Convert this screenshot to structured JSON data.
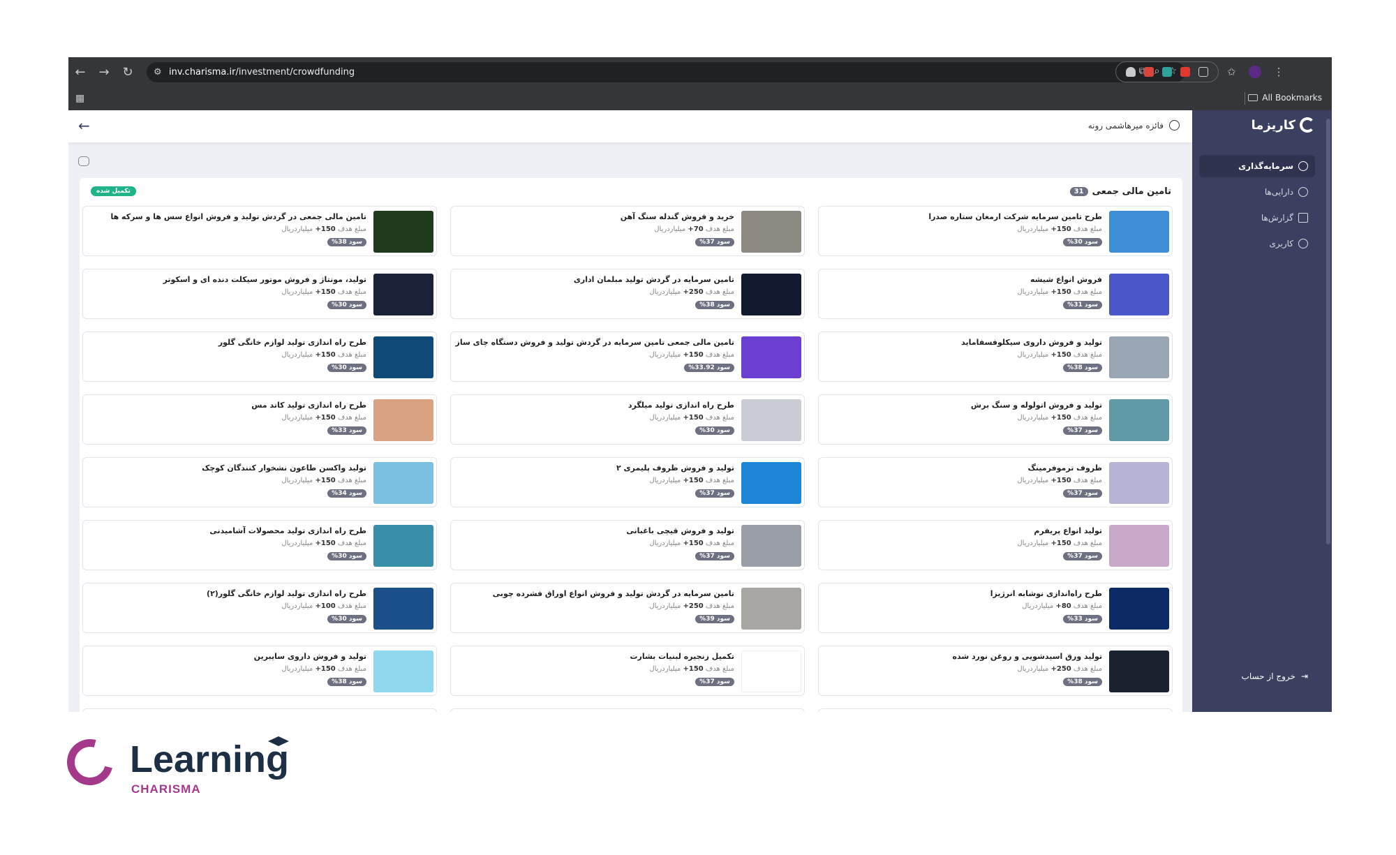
{
  "browser": {
    "url_host": "inv.charisma.ir",
    "url_path": "/investment/crowdfunding",
    "all_bookmarks": "All Bookmarks"
  },
  "sidebar": {
    "brand": "کاریزما",
    "items": [
      {
        "label": "سرمایه‌گذاری",
        "active": true,
        "icon": "chart-icon"
      },
      {
        "label": "دارایی‌ها",
        "active": false,
        "icon": "pie-icon"
      },
      {
        "label": "گزارش‌ها",
        "active": false,
        "icon": "document-icon"
      },
      {
        "label": "کاربری",
        "active": false,
        "icon": "user-icon"
      }
    ],
    "logout": "خروج از حساب"
  },
  "topbar": {
    "user_name": "فائزه میرهاشمی رونه"
  },
  "panel": {
    "title": "تامین مالی جمعی",
    "count": "31",
    "done_badge": "تکمیل شده"
  },
  "target_prefix": "مبلغ هدف",
  "unit": "میلیارد‌ریال",
  "profit_label": "سود",
  "cards": [
    {
      "title": "طرح تامین سرمایه شرکت ارمغان ستاره صدرا",
      "target": "150+",
      "profit": "30%",
      "color": "#3f8fd6"
    },
    {
      "title": "خرید و فروش گندله سنگ آهن",
      "target": "70+",
      "profit": "37%",
      "color": "#8d8a82"
    },
    {
      "title": "تامین مالی جمعی در گردش تولید و فروش انواع سس ها و سرکه ها",
      "target": "150+",
      "profit": "38%",
      "color": "#1f3a1c"
    },
    {
      "title": "فروش انواع شیشه",
      "target": "150+",
      "profit": "31%",
      "color": "#4b56c9"
    },
    {
      "title": "تامین سرمایه در گردش تولید مبلمان اداری",
      "target": "250+",
      "profit": "38%",
      "color": "#111a2e"
    },
    {
      "title": "تولید، مونتاژ و فروش موتور سیکلت دنده ای و اسکوتر",
      "target": "150+",
      "profit": "30%",
      "color": "#1a2238"
    },
    {
      "title": "تولید و فروش داروی سیکلوفسفاماید",
      "target": "150+",
      "profit": "38%",
      "color": "#9aa6b4"
    },
    {
      "title": "تامین مالی جمعی تامین سرمایه در گردش تولید و فروش دستگاه چای ساز",
      "target": "150+",
      "profit": "33.92%",
      "color": "#6b3fd1"
    },
    {
      "title": "طرح راه اندازی تولید لوازم خانگی گلور",
      "target": "150+",
      "profit": "30%",
      "color": "#0f4a78"
    },
    {
      "title": "تولید و فروش اتولوله و سنگ برش",
      "target": "150+",
      "profit": "37%",
      "color": "#5f9aa6"
    },
    {
      "title": "طرح راه اندازی تولید میلگرد",
      "target": "150+",
      "profit": "30%",
      "color": "#c9ccd2"
    },
    {
      "title": "طرح راه اندازی تولید کاتد مس",
      "target": "150+",
      "profit": "33%",
      "color": "#d9a383"
    },
    {
      "title": "ظروف ترموفرمینگ",
      "target": "150+",
      "profit": "37%",
      "color": "#b8b4d6"
    },
    {
      "title": "تولید و فروش ظروف پلیمری ۲",
      "target": "150+",
      "profit": "37%",
      "color": "#1e86d6"
    },
    {
      "title": "تولید واکسن طاعون نشخوار کنندگان کوچک",
      "target": "150+",
      "profit": "34%",
      "color": "#7cc0e0"
    },
    {
      "title": "تولید انواع پریفرم",
      "target": "150+",
      "profit": "37%",
      "color": "#c9a9c9"
    },
    {
      "title": "تولید و فروش قیچی باغبانی",
      "target": "150+",
      "profit": "37%",
      "color": "#9a9ea6"
    },
    {
      "title": "طرح راه اندازی تولید محصولات آشامیدنی",
      "target": "150+",
      "profit": "30%",
      "color": "#3a8fa8"
    },
    {
      "title": "طرح راه‌اندازی نوشابه انرژیزا",
      "target": "80+",
      "profit": "33%",
      "color": "#0c2a66"
    },
    {
      "title": "تامین سرمایه در گردش تولید و فروش انواع اوراق فشرده چوبی",
      "target": "250+",
      "profit": "39%",
      "color": "#a8a6a2"
    },
    {
      "title": "طرح راه اندازی تولید لوازم خانگی گلور(۲)",
      "target": "100+",
      "profit": "30%",
      "color": "#1b4f8a"
    },
    {
      "title": "تولید ورق اسیدشویی و روغن نورد شده",
      "target": "250+",
      "profit": "38%",
      "color": "#1a2230"
    },
    {
      "title": "تکمیل زنجیره لبنیات بشارت",
      "target": "150+",
      "profit": "37%",
      "color": "#ffffff"
    },
    {
      "title": "تولید و فروش داروی سایبرین",
      "target": "150+",
      "profit": "38%",
      "color": "#8fd8ee"
    }
  ],
  "footer_logo": {
    "word": "Learning",
    "sub": "CHARISMA"
  }
}
